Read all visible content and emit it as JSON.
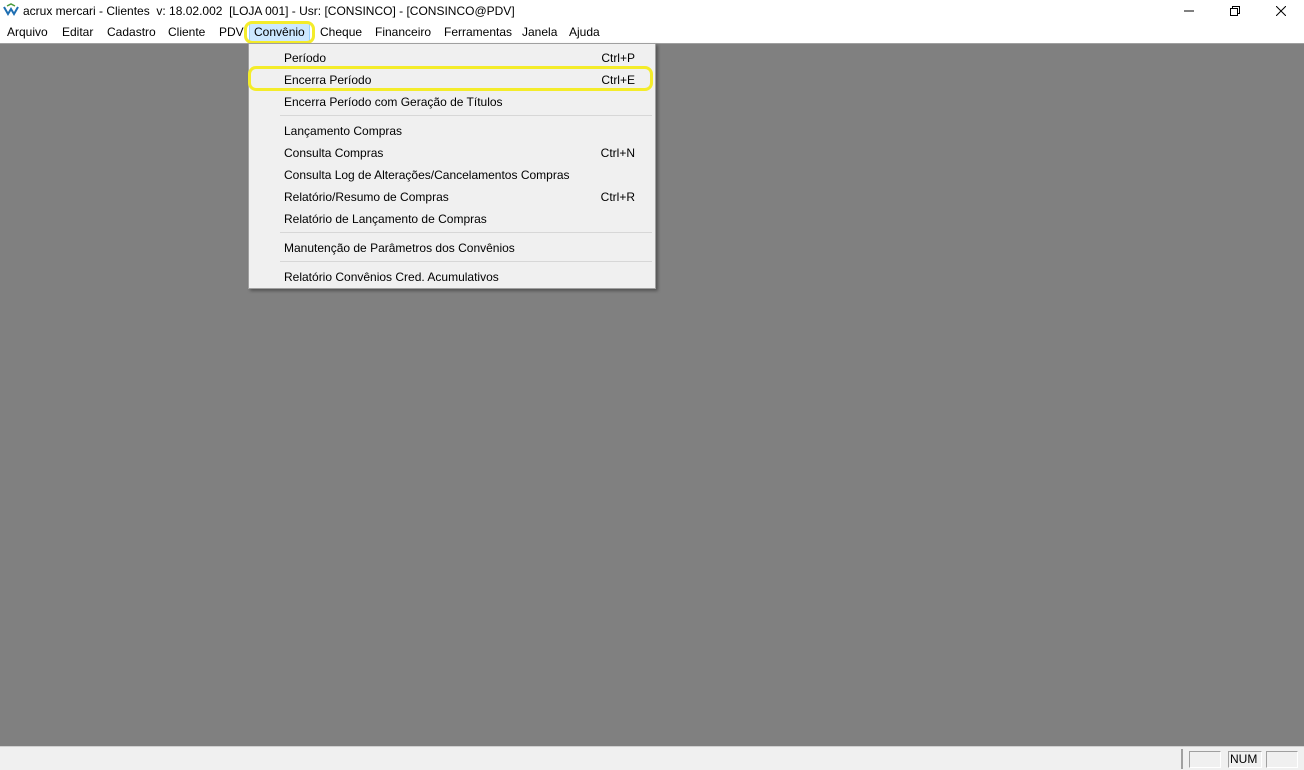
{
  "window": {
    "title": "acrux mercari - Clientes  v: 18.02.002  [LOJA 001] - Usr: [CONSINCO] - [CONSINCO@PDV]",
    "icon": "app-logo-icon",
    "controls": {
      "minimize": "minimize-icon",
      "maximize": "restore-icon",
      "close": "close-icon"
    }
  },
  "menubar": {
    "items": [
      {
        "label": "Arquivo"
      },
      {
        "label": "Editar"
      },
      {
        "label": "Cadastro"
      },
      {
        "label": "Cliente"
      },
      {
        "label": "PDV"
      },
      {
        "label": "Convênio"
      },
      {
        "label": "Cheque"
      },
      {
        "label": "Financeiro"
      },
      {
        "label": "Ferramentas"
      },
      {
        "label": "Janela"
      },
      {
        "label": "Ajuda"
      }
    ],
    "active": "Convênio"
  },
  "dropdown": {
    "items": [
      {
        "label": "Período",
        "shortcut": "Ctrl+P"
      },
      {
        "label": "Encerra Período",
        "shortcut": "Ctrl+E"
      },
      {
        "label": "Encerra Período com Geração de Títulos",
        "shortcut": ""
      },
      {
        "label": "Lançamento Compras",
        "shortcut": ""
      },
      {
        "label": "Consulta Compras",
        "shortcut": "Ctrl+N"
      },
      {
        "label": "Consulta Log de Alterações/Cancelamentos Compras",
        "shortcut": ""
      },
      {
        "label": "Relatório/Resumo de Compras",
        "shortcut": "Ctrl+R"
      },
      {
        "label": "Relatório de Lançamento de Compras",
        "shortcut": ""
      },
      {
        "label": "Manutenção de Parâmetros dos Convênios",
        "shortcut": ""
      },
      {
        "label": "Relatório Convênios Cred. Acumulativos",
        "shortcut": ""
      }
    ],
    "highlighted": "Encerra Período"
  },
  "statusbar": {
    "num_indicator": "NUM"
  },
  "colors": {
    "mdi_background": "#808080",
    "menu_background": "#f0f0f0",
    "highlight_outline": "#f4ec2a",
    "active_menu": "#cce8ff"
  }
}
